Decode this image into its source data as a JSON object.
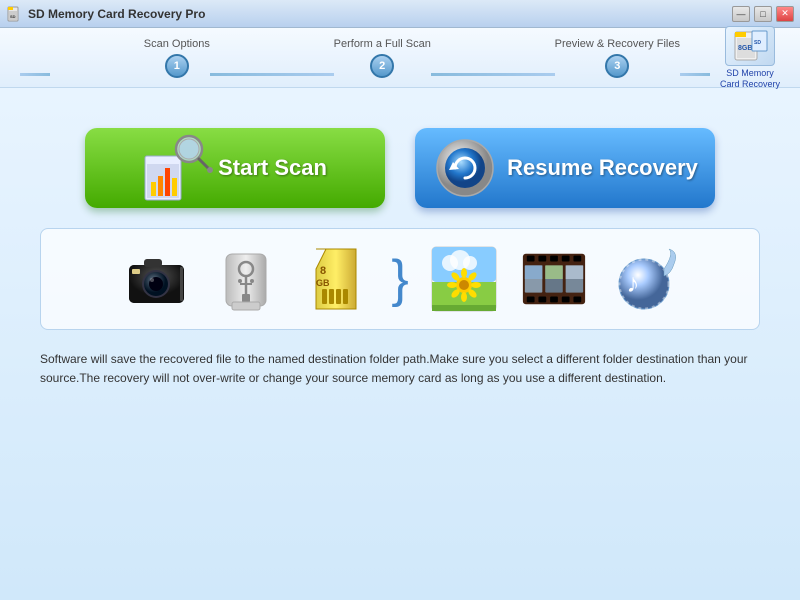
{
  "titleBar": {
    "title": "SD Memory Card Recovery Pro",
    "controls": {
      "minimize": "—",
      "maximize": "□",
      "close": "✕"
    }
  },
  "steps": [
    {
      "label": "Scan Options",
      "number": "1"
    },
    {
      "label": "Perform a Full Scan",
      "number": "2"
    },
    {
      "label": "Preview & Recovery Files",
      "number": "3"
    }
  ],
  "logo": {
    "line1": "SD Memory",
    "line2": "Card Recovery"
  },
  "buttons": {
    "startScan": "Start Scan",
    "resumeRecovery": "Resume Recovery"
  },
  "description": "Software will save the recovered file to the named destination folder path.Make sure you select a different folder destination than your source.The recovery will not over-write or change your source memory card as long as you use a different destination."
}
